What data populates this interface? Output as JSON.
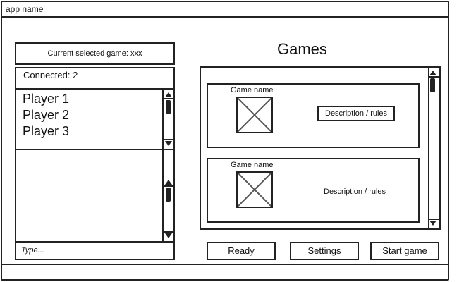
{
  "app": {
    "title": "app name"
  },
  "left": {
    "current_game": "Current selected game: xxx",
    "connected": "Connected: 2",
    "players": [
      "Player 1",
      "Player 2",
      "Player 3"
    ],
    "chat_input": {
      "placeholder": "Type..."
    }
  },
  "main": {
    "title": "Games",
    "games": [
      {
        "name": "Game name",
        "description": "Description / rules",
        "selected_description": true
      },
      {
        "name": "Game name",
        "description": "Description / rules",
        "selected_description": false
      }
    ]
  },
  "actions": {
    "ready_label": "Ready",
    "settings_label": "Settings",
    "start_label": "Start game"
  },
  "icons": {
    "image_placeholder": "image-placeholder-icon",
    "scroll_up": "scroll-up-arrow-icon",
    "scroll_down": "scroll-down-arrow-icon"
  }
}
